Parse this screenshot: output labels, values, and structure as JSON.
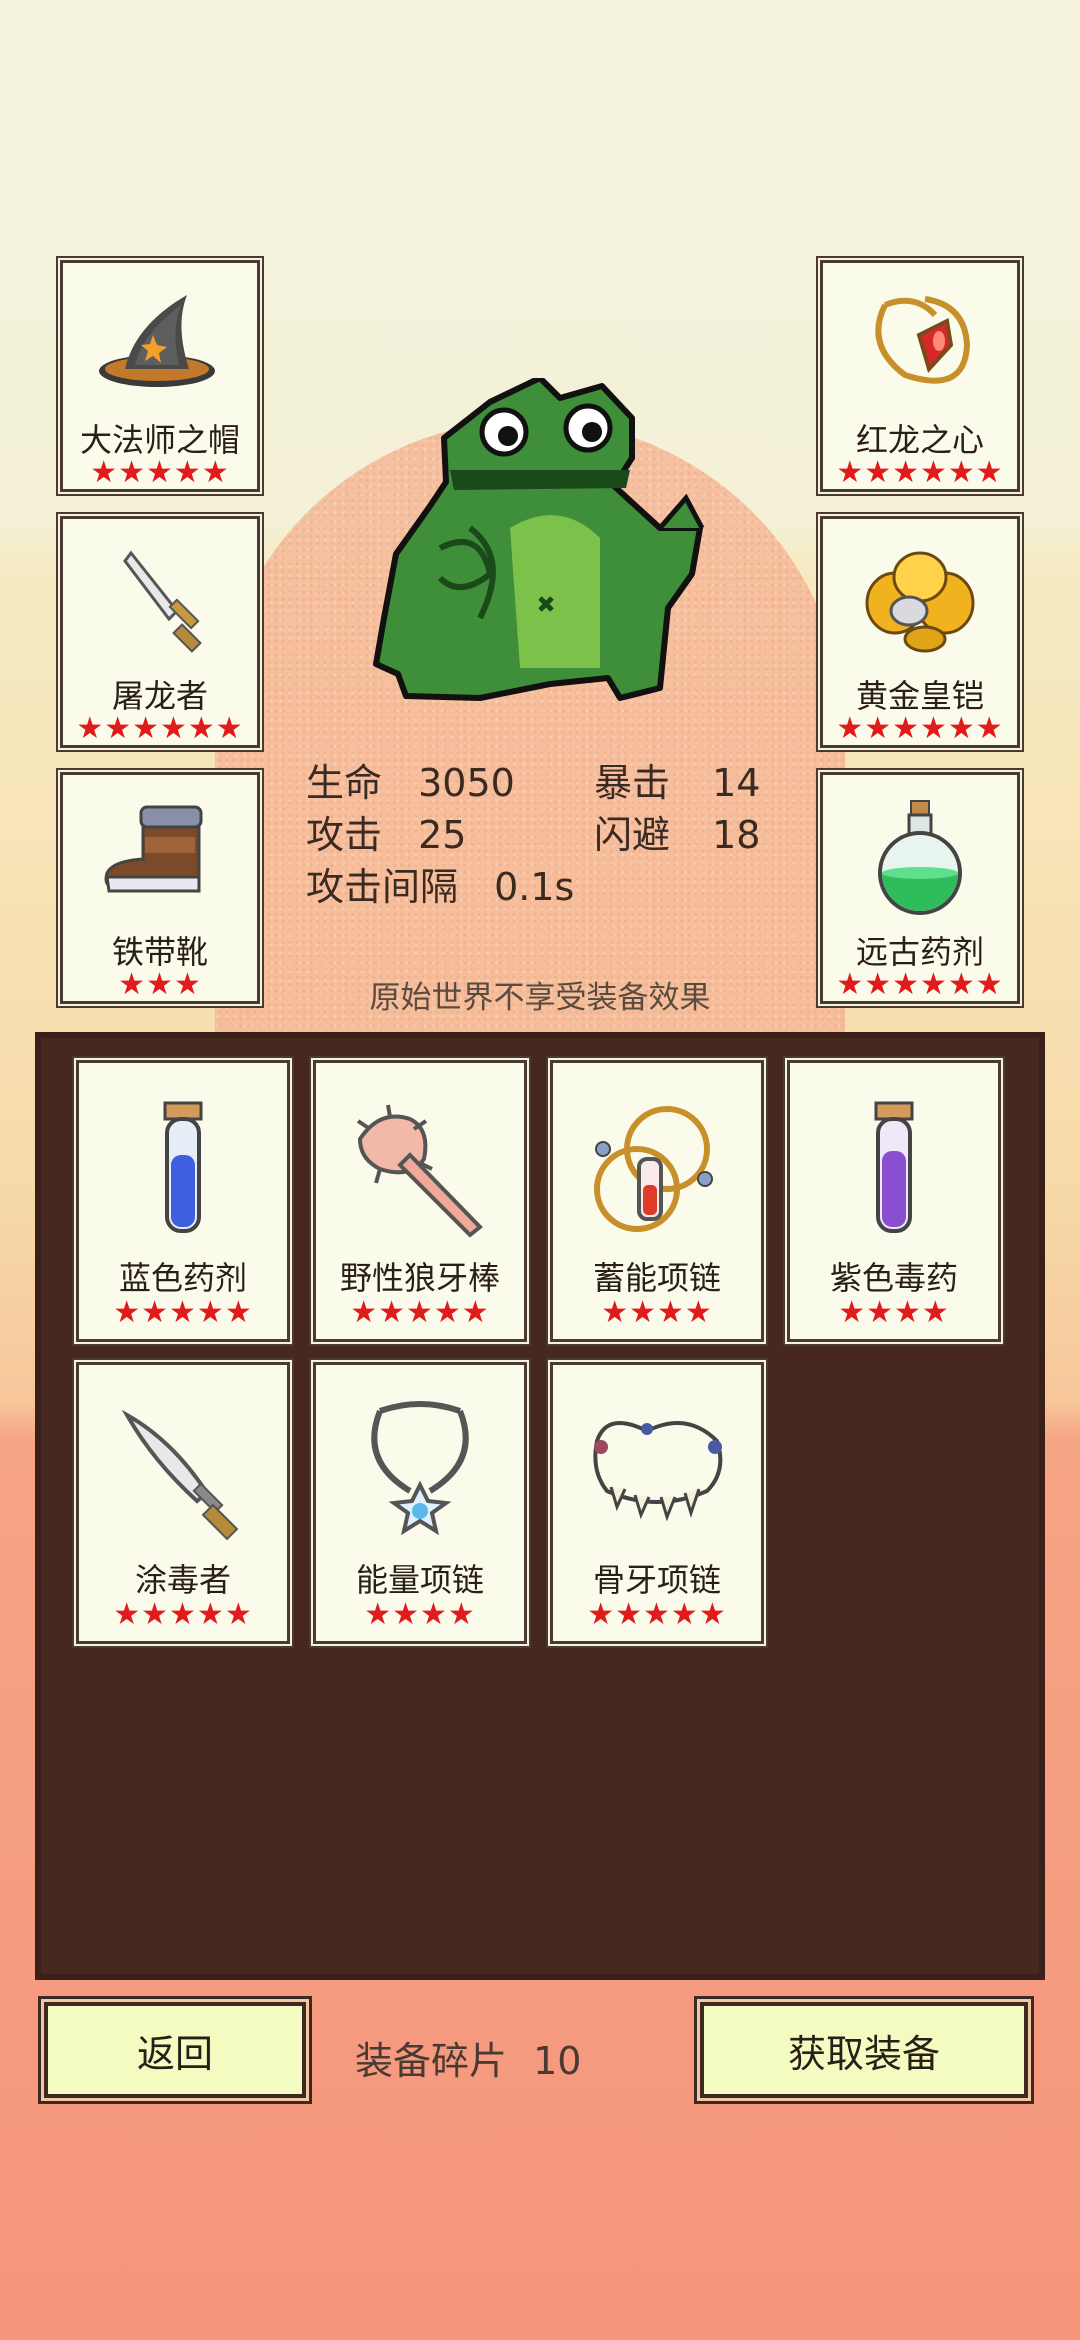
{
  "side_left": [
    {
      "name": "大法师之帽",
      "stars": "★★★★★",
      "icon": "wizard-hat-icon"
    },
    {
      "name": "屠龙者",
      "stars": "★★★★★★",
      "icon": "dagger-icon"
    },
    {
      "name": "铁带靴",
      "stars": "★★★",
      "icon": "boot-icon"
    }
  ],
  "side_right": [
    {
      "name": "红龙之心",
      "stars": "★★★★★★",
      "icon": "ruby-amulet-icon"
    },
    {
      "name": "黄金皇铠",
      "stars": "★★★★★★",
      "icon": "gold-armor-icon"
    },
    {
      "name": "远古药剂",
      "stars": "★★★★★★",
      "icon": "green-potion-icon"
    }
  ],
  "stats": {
    "hp_label": "生命",
    "hp_value": "3050",
    "crit_label": "暴击",
    "crit_value": "14",
    "atk_label": "攻击",
    "atk_value": "25",
    "dodge_label": "闪避",
    "dodge_value": "18",
    "interval_label": "攻击间隔",
    "interval_value": "0.1s"
  },
  "note": "原始世界不享受装备效果",
  "inventory": [
    {
      "name": "蓝色药剂",
      "stars": "★★★★★",
      "icon": "blue-vial-icon"
    },
    {
      "name": "野性狼牙棒",
      "stars": "★★★★★",
      "icon": "spiked-club-icon"
    },
    {
      "name": "蓄能项链",
      "stars": "★★★★",
      "icon": "charge-necklace-icon"
    },
    {
      "name": "紫色毒药",
      "stars": "★★★★",
      "icon": "purple-vial-icon"
    },
    {
      "name": "涂毒者",
      "stars": "★★★★★",
      "icon": "poison-blade-icon"
    },
    {
      "name": "能量项链",
      "stars": "★★★★",
      "icon": "energy-necklace-icon"
    },
    {
      "name": "骨牙项链",
      "stars": "★★★★★",
      "icon": "bone-necklace-icon"
    }
  ],
  "footer": {
    "back_label": "返回",
    "shards_label": "装备碎片",
    "shards_value": "10",
    "get_label": "获取装备"
  },
  "colors": {
    "star": "#e11b1b",
    "bag_bg": "#47281f",
    "button_bg": "#f4fbc1"
  }
}
